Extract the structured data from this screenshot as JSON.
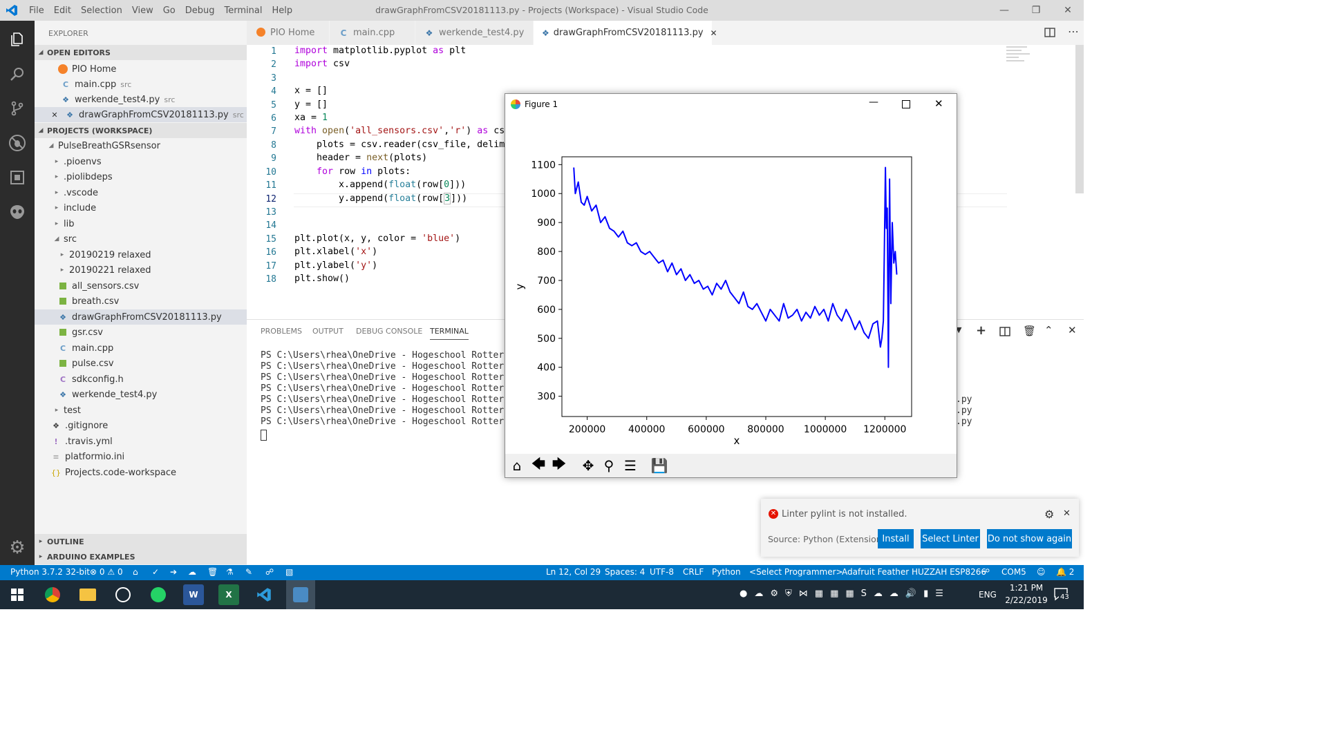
{
  "window": {
    "title": "drawGraphFromCSV20181113.py - Projects (Workspace) - Visual Studio Code",
    "menu": [
      "File",
      "Edit",
      "Selection",
      "View",
      "Go",
      "Debug",
      "Terminal",
      "Help"
    ]
  },
  "sidebar": {
    "header": "EXPLORER",
    "open_editors_title": "OPEN EDITORS",
    "open_editors": [
      {
        "name": "PIO Home",
        "desc": "",
        "icon": "pio-icon"
      },
      {
        "name": "main.cpp",
        "desc": "src",
        "icon": "cpp-icon"
      },
      {
        "name": "werkende_test4.py",
        "desc": "src",
        "icon": "python-icon"
      },
      {
        "name": "drawGraphFromCSV20181113.py",
        "desc": "src",
        "icon": "python-icon"
      }
    ],
    "projects_title": "PROJECTS (WORKSPACE)",
    "tree": [
      {
        "name": "PulseBreathGSRsensor",
        "icon": "folder-open"
      },
      {
        "name": ".pioenvs",
        "icon": "folder"
      },
      {
        "name": ".piolibdeps",
        "icon": "folder"
      },
      {
        "name": ".vscode",
        "icon": "folder"
      },
      {
        "name": "include",
        "icon": "folder"
      },
      {
        "name": "lib",
        "icon": "folder"
      },
      {
        "name": "src",
        "icon": "folder-open"
      },
      {
        "name": "20190219 relaxed",
        "icon": "folder"
      },
      {
        "name": "20190221 relaxed",
        "icon": "folder"
      },
      {
        "name": "all_sensors.csv",
        "icon": "csv-icon"
      },
      {
        "name": "breath.csv",
        "icon": "csv-icon"
      },
      {
        "name": "drawGraphFromCSV20181113.py",
        "icon": "python-icon"
      },
      {
        "name": "gsr.csv",
        "icon": "csv-icon"
      },
      {
        "name": "main.cpp",
        "icon": "cpp-icon"
      },
      {
        "name": "pulse.csv",
        "icon": "csv-icon"
      },
      {
        "name": "sdkconfig.h",
        "icon": "c-icon"
      },
      {
        "name": "werkende_test4.py",
        "icon": "python-icon"
      },
      {
        "name": "test",
        "icon": "folder"
      },
      {
        "name": ".gitignore",
        "icon": "git-icon"
      },
      {
        "name": ".travis.yml",
        "icon": "yml-icon"
      },
      {
        "name": "platformio.ini",
        "icon": "ini-icon"
      },
      {
        "name": "Projects.code-workspace",
        "icon": "json-icon"
      }
    ],
    "outline_title": "OUTLINE",
    "arduino_title": "ARDUINO EXAMPLES"
  },
  "tabs": [
    {
      "label": "PIO Home",
      "icon": "pio-icon"
    },
    {
      "label": "main.cpp",
      "icon": "cpp-icon"
    },
    {
      "label": "werkende_test4.py",
      "icon": "python-icon"
    },
    {
      "label": "drawGraphFromCSV20181113.py",
      "icon": "python-icon"
    }
  ],
  "editor": {
    "line_numbers": [
      "1",
      "2",
      "3",
      "4",
      "5",
      "6",
      "7",
      "8",
      "9",
      "10",
      "11",
      "12",
      "13",
      "14",
      "15",
      "16",
      "17",
      "18"
    ]
  },
  "panel": {
    "tabs": [
      "PROBLEMS",
      "OUTPUT",
      "DEBUG CONSOLE",
      "TERMINAL"
    ],
    "terminal_prompt": "PS C:\\Users\\rhea\\OneDrive - Hogeschool Rotterdam",
    "terminal_tails": [
      ".py",
      ".py",
      ".py"
    ]
  },
  "figure": {
    "title": "Figure 1",
    "toolbar": [
      "home-icon",
      "back-icon",
      "forward-icon",
      "pan-icon",
      "zoom-icon",
      "configure-icon",
      "save-icon"
    ]
  },
  "chart_data": {
    "type": "line",
    "title": "",
    "xlabel": "x",
    "ylabel": "y",
    "xlim": [
      115000,
      1290000
    ],
    "ylim": [
      230000,
      1127
    ],
    "x_ticks": [
      "200000",
      "400000",
      "600000",
      "800000",
      "1000000",
      "1200000"
    ],
    "y_ticks": [
      "1100",
      "1000",
      "900",
      "800",
      "700",
      "600",
      "500",
      "400",
      "300"
    ],
    "color": "#0000ff",
    "series": [
      {
        "x": [
          155000,
          160000,
          170000,
          180000,
          190000,
          200000,
          215000,
          230000,
          245000,
          260000,
          275000,
          290000,
          305000,
          320000,
          335000,
          350000,
          365000,
          380000,
          395000,
          410000,
          425000,
          440000,
          455000,
          470000,
          485000,
          500000,
          515000,
          530000,
          545000,
          560000,
          575000,
          590000,
          605000,
          620000,
          635000,
          650000,
          665000,
          680000,
          695000,
          710000,
          725000,
          740000,
          755000,
          770000,
          785000,
          800000,
          815000,
          830000,
          845000,
          860000,
          875000,
          890000,
          905000,
          920000,
          935000,
          950000,
          965000,
          980000,
          995000,
          1010000,
          1025000,
          1040000,
          1055000,
          1070000,
          1085000,
          1100000,
          1115000,
          1130000,
          1145000,
          1160000,
          1175000,
          1185000,
          1190000,
          1195000,
          1198000,
          1202000,
          1205000,
          1208000,
          1212000,
          1216000,
          1220000,
          1225000,
          1230000,
          1235000,
          1240000
        ],
        "y": [
          1090,
          1000,
          1040,
          970,
          960,
          990,
          940,
          960,
          900,
          920,
          880,
          870,
          850,
          870,
          830,
          820,
          830,
          800,
          790,
          800,
          780,
          760,
          770,
          730,
          760,
          720,
          740,
          700,
          720,
          690,
          700,
          670,
          680,
          650,
          690,
          670,
          700,
          660,
          640,
          620,
          660,
          610,
          600,
          620,
          590,
          560,
          600,
          580,
          560,
          620,
          570,
          580,
          600,
          560,
          590,
          570,
          610,
          580,
          600,
          560,
          620,
          580,
          560,
          600,
          570,
          530,
          560,
          520,
          500,
          550,
          560,
          470,
          500,
          560,
          780,
          1090,
          880,
          950,
          400,
          1050,
          620,
          900,
          760,
          800,
          720
        ]
      }
    ]
  },
  "notification": {
    "message": "Linter pylint is not installed.",
    "source": "Source: Python (Extension)",
    "buttons": [
      "Install",
      "Select Linter",
      "Do not show again"
    ]
  },
  "statusbar": {
    "python": "Python 3.7.2 32-bit",
    "errors": "0",
    "warnings": "0",
    "position": "Ln 12, Col 29",
    "spaces": "Spaces: 4",
    "encoding": "UTF-8",
    "eol": "CRLF",
    "language": "Python",
    "programmer": "<Select Programmer>",
    "board": "Adafruit Feather HUZZAH ESP8266",
    "port": "COM5",
    "bell_count": "2"
  },
  "taskbar": {
    "lang": "ENG",
    "time": "1:21 PM",
    "date": "2/22/2019",
    "notif_count": "43"
  }
}
